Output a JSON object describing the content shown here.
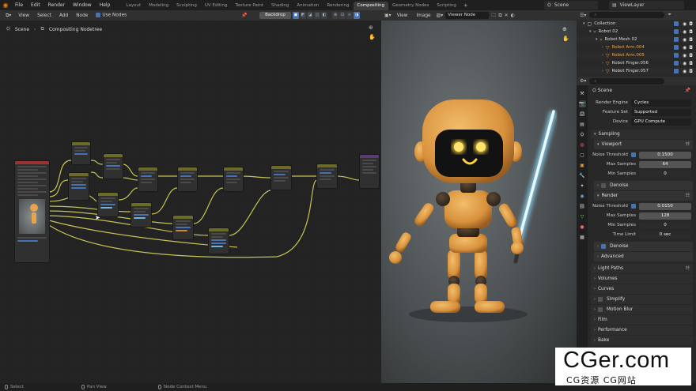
{
  "topbar": {
    "menus": [
      "File",
      "Edit",
      "Render",
      "Window",
      "Help"
    ],
    "workspaces": [
      "Layout",
      "Modeling",
      "Sculpting",
      "UV Editing",
      "Texture Paint",
      "Shading",
      "Animation",
      "Rendering",
      "Compositing",
      "Geometry Nodes",
      "Scripting"
    ],
    "active_workspace": "Compositing",
    "scene": "Scene",
    "view_layer": "ViewLayer"
  },
  "node_editor": {
    "menus": [
      "View",
      "Select",
      "Add",
      "Node"
    ],
    "use_nodes_label": "Use Nodes",
    "backdrop_label": "Backdrop",
    "breadcrumb_scene": "Scene",
    "breadcrumb_tree": "Compositing Nodetree"
  },
  "viewer": {
    "menus": [
      "View",
      "Image"
    ],
    "node_name": "Viewer Node"
  },
  "outliner": {
    "rows": [
      {
        "label": "Collection",
        "indent": 0,
        "orange": false
      },
      {
        "label": "Robot 02",
        "indent": 1,
        "orange": false
      },
      {
        "label": "Robot Mesh 02",
        "indent": 2,
        "orange": false
      },
      {
        "label": "Robot Arm.004",
        "indent": 3,
        "orange": true
      },
      {
        "label": "Robot Arm.005",
        "indent": 3,
        "orange": true
      },
      {
        "label": "Robot Finger.056",
        "indent": 3,
        "orange": false
      },
      {
        "label": "Robot Finger.057",
        "indent": 3,
        "orange": false
      }
    ]
  },
  "properties": {
    "scene_label": "Scene",
    "render_engine_label": "Render Engine",
    "render_engine": "Cycles",
    "feature_set_label": "Feature Set",
    "feature_set": "Supported",
    "device_label": "Device",
    "device": "GPU Compute",
    "sampling_label": "Sampling",
    "viewport_label": "Viewport",
    "noise_threshold_label": "Noise Threshold",
    "viewport_noise_threshold": "0.1500",
    "max_samples_label": "Max Samples",
    "viewport_max_samples": "64",
    "min_samples_label": "Min Samples",
    "viewport_min_samples": "0",
    "denoise_label": "Denoise",
    "render_label": "Render",
    "render_noise_threshold": "0.0150",
    "render_max_samples": "128",
    "render_min_samples": "0",
    "time_limit_label": "Time Limit",
    "time_limit": "0 sec",
    "advanced_label": "Advanced",
    "panels": [
      "Light Paths",
      "Volumes",
      "Curves",
      "Simplify",
      "Motion Blur",
      "Film",
      "Performance",
      "Bake"
    ]
  },
  "statusbar": {
    "left": "Select",
    "middle": "Pan View",
    "right": "Node Context Menu"
  },
  "watermark": {
    "main": "CGer.com",
    "sub": "CG资源 CG网站"
  },
  "colors": {
    "accent": "#4772b3",
    "active_tab": "#3d3d3d",
    "node_header": "#6b6b27",
    "wire": "#d8d55a",
    "robot_body": "#e6a44c",
    "saber": "#aee4ff"
  }
}
